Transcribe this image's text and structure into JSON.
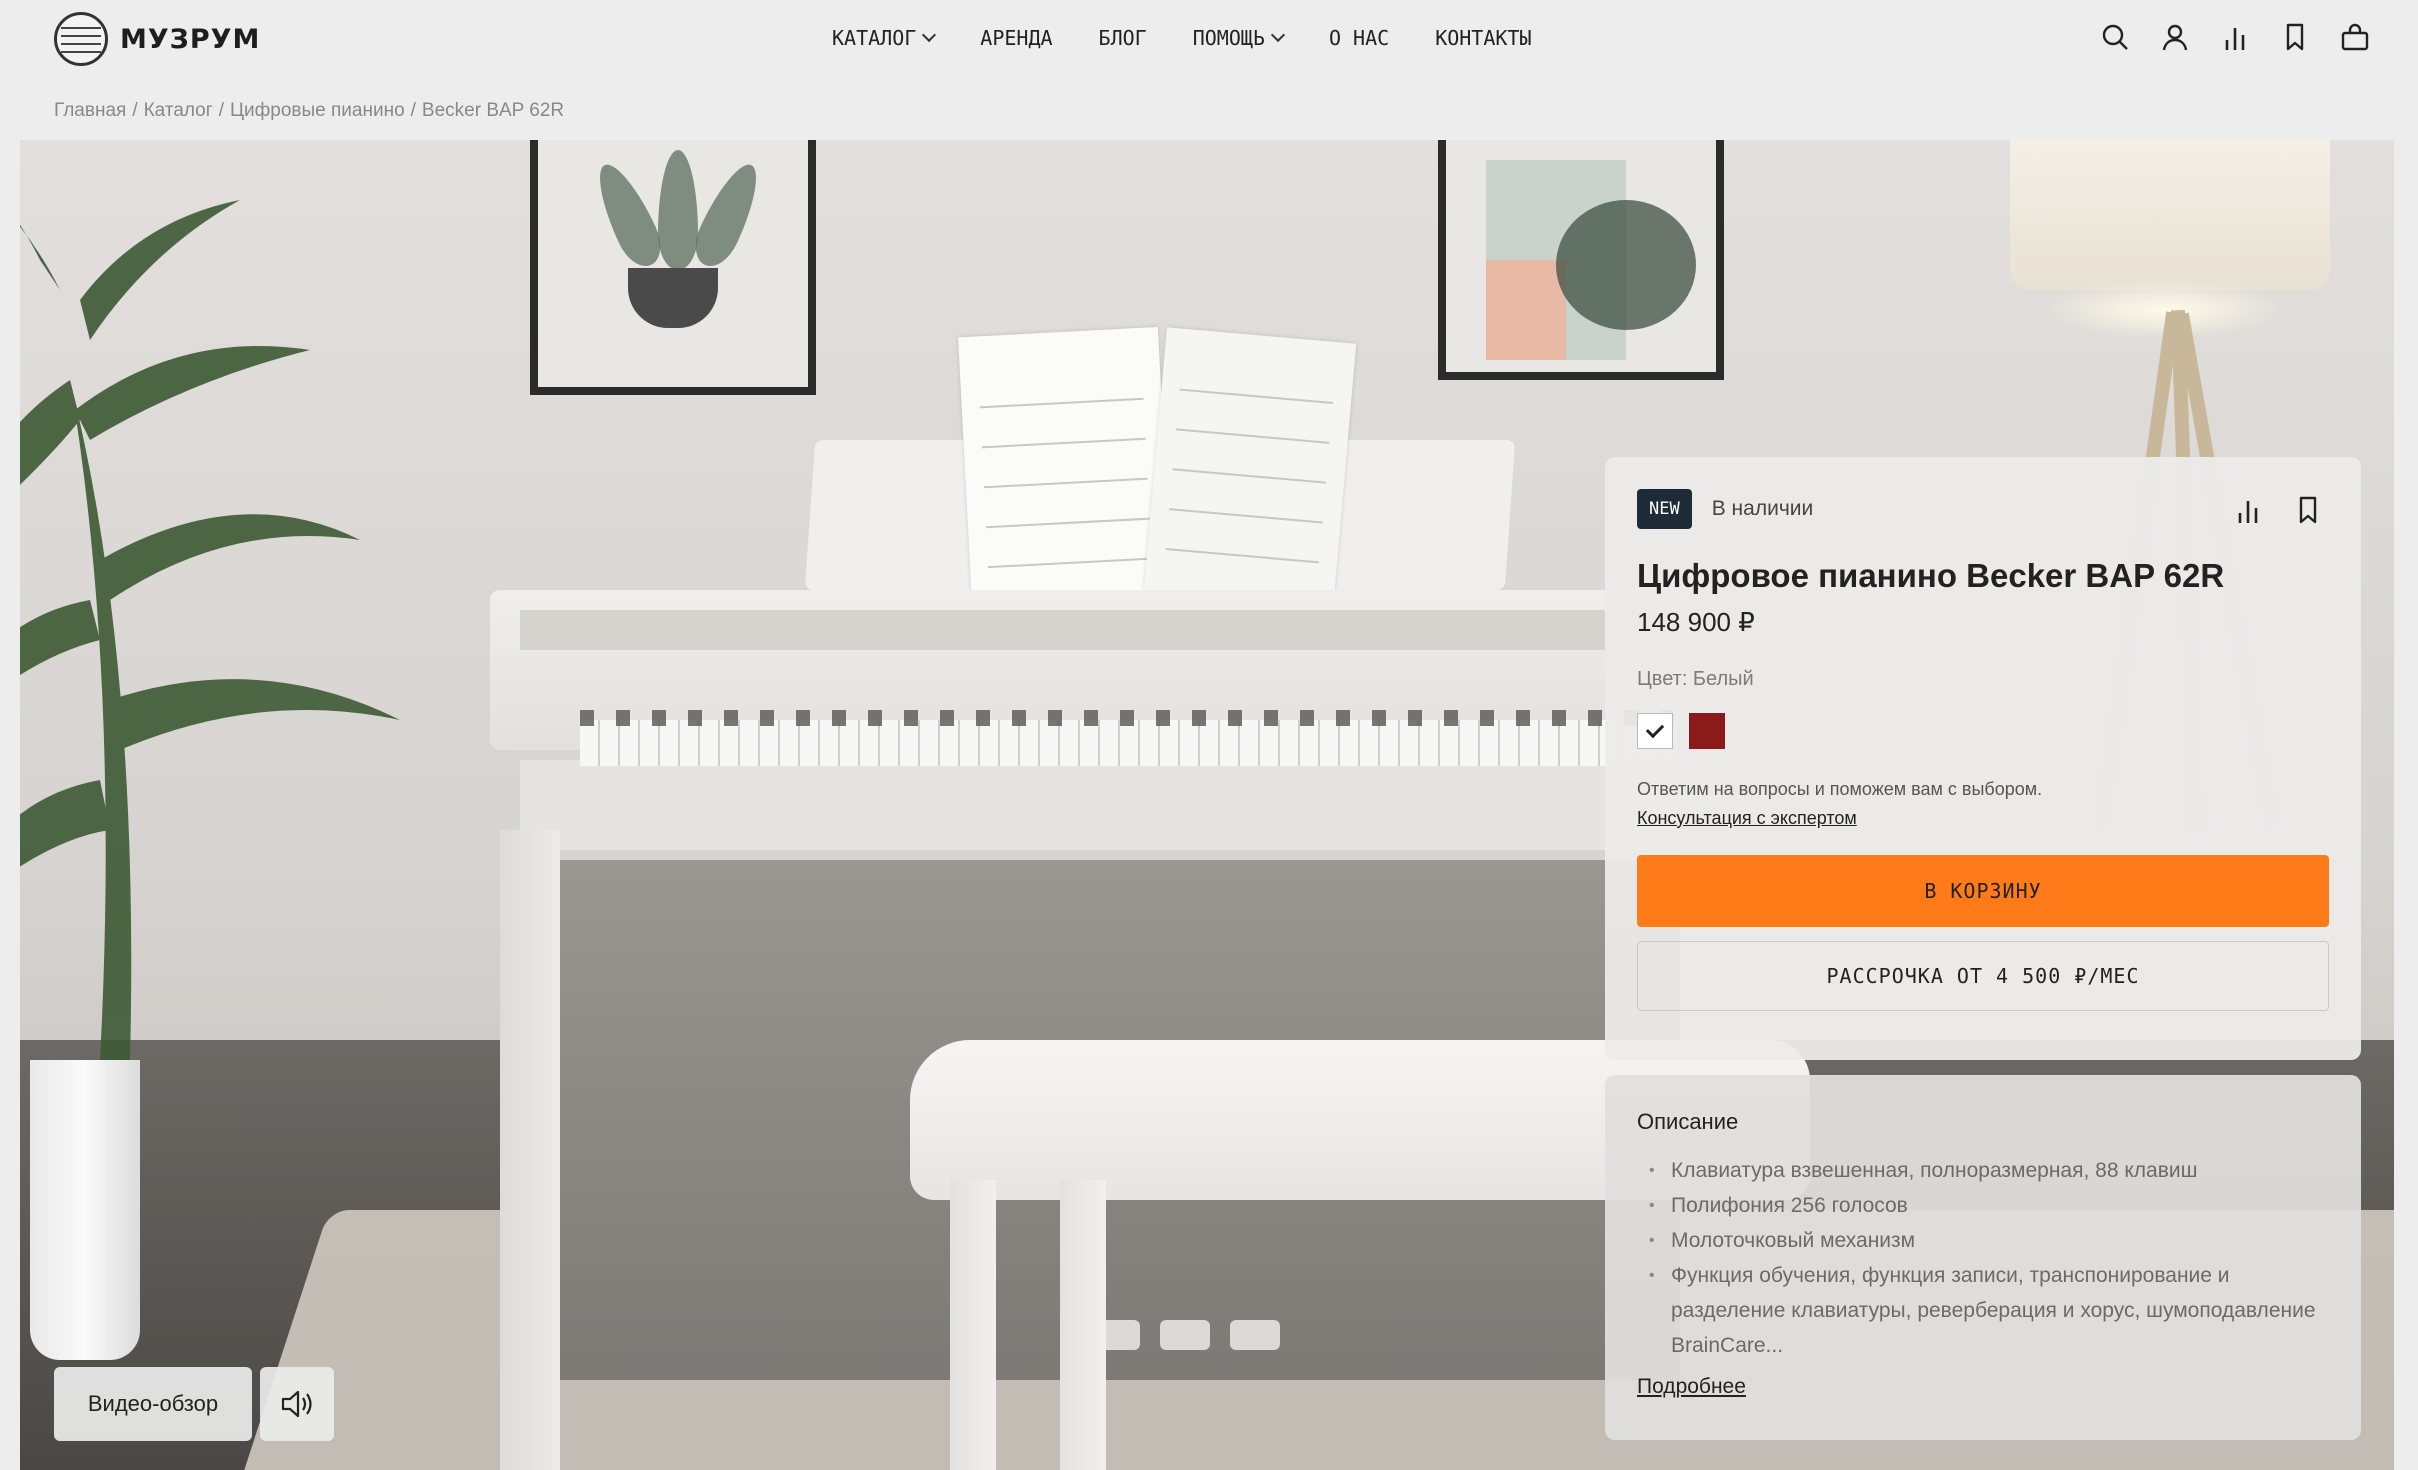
{
  "header": {
    "logo_text": "МУЗРУМ",
    "nav": [
      {
        "label": "КАТАЛОГ",
        "has_dropdown": true
      },
      {
        "label": "АРЕНДА",
        "has_dropdown": false
      },
      {
        "label": "БЛОГ",
        "has_dropdown": false
      },
      {
        "label": "ПОМОЩЬ",
        "has_dropdown": true
      },
      {
        "label": "О НАС",
        "has_dropdown": false
      },
      {
        "label": "КОНТАКТЫ",
        "has_dropdown": false
      }
    ],
    "icons": [
      "search-icon",
      "user-icon",
      "compare-icon",
      "bookmark-icon",
      "cart-icon"
    ]
  },
  "breadcrumb": [
    "Главная",
    "Каталог",
    "Цифровые пианино",
    "Becker BAP 62R"
  ],
  "hero": {
    "video_button": "Видео-обзор",
    "sound_icon": "speaker-icon"
  },
  "product": {
    "badge": "NEW",
    "stock": "В наличии",
    "title": "Цифровое пианино Becker BAP 62R",
    "price": "148 900 ₽",
    "color_label": "Цвет: Белый",
    "colors": [
      {
        "name": "white",
        "hex": "#ffffff",
        "selected": true
      },
      {
        "name": "red",
        "hex": "#8b1a1a",
        "selected": false
      }
    ],
    "help_text": "Ответим на вопросы и поможем вам с выбором.",
    "expert_link": "Консультация с экспертом",
    "cart_button": "В КОРЗИНУ",
    "installment_button": "РАССРОЧКА ОТ 4 500 ₽/МЕС",
    "accent_color": "#ff7a19"
  },
  "description": {
    "title": "Описание",
    "items": [
      "Клавиатура взвешенная, полноразмерная, 88 клавиш",
      "Полифония 256 голосов",
      "Молоточковый механизм",
      "Функция обучения, функция записи, транспонирование и разделение клавиатуры, реверберация и хорус, шумоподавление BrainCare..."
    ],
    "more_link": "Подробнее"
  }
}
